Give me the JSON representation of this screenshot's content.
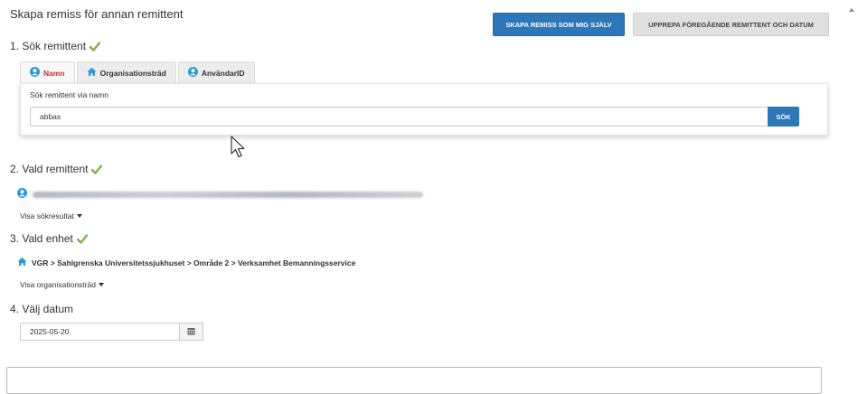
{
  "page": {
    "title": "Skapa remiss för annan remittent"
  },
  "actions": {
    "self_label": "SKAPA REMISS SOM MIG SJÄLV",
    "repeat_label": "UPPREPA FÖREGÅENDE REMITTENT OCH DATUM"
  },
  "steps": {
    "search_title": "1. Sök remittent",
    "selected_title": "2. Vald remittent",
    "unit_title": "3. Vald enhet",
    "date_title": "4. Välj datum"
  },
  "search": {
    "tabs": [
      {
        "label": "Namn",
        "icon": "person-icon"
      },
      {
        "label": "Organisationsträd",
        "icon": "home-icon"
      },
      {
        "label": "AnvändarID",
        "icon": "person-icon"
      }
    ],
    "label": "Sök remittent via namn",
    "value": "abbas",
    "button_label": "SÖK"
  },
  "selected": {
    "toggle_label": "Visa sökresultat"
  },
  "unit": {
    "path": "VGR > Sahlgrenska Universitetssjukhuset > Område 2 > Verksamhet Bemanningsservice",
    "toggle_label": "Visa organisationsträd"
  },
  "date": {
    "value": "2025-05-20"
  },
  "colors": {
    "primary": "#2b77b9",
    "active_tab_text": "#c9302c",
    "check": "#7cb342",
    "home_icon": "#2b9bd7"
  }
}
